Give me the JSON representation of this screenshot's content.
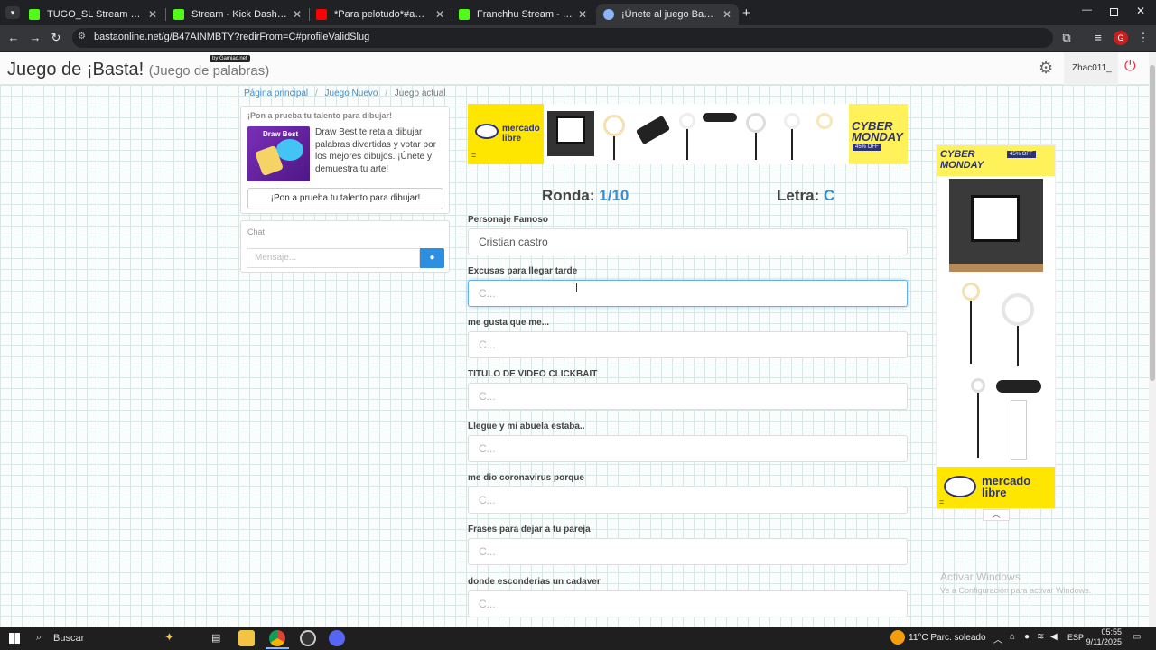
{
  "browser": {
    "tabs": [
      {
        "title": "TUGO_SL Stream - Watch Live o",
        "color": "#53fc18"
      },
      {
        "title": "Stream - Kick Dashboard",
        "color": "#53fc18"
      },
      {
        "title": "*Para pelotudo*#auronplay #tu",
        "color": "#ff0000"
      },
      {
        "title": "Franchhu Stream - Watch Live o",
        "color": "#53fc18"
      },
      {
        "title": "¡Únete al juego Basta!",
        "color": "#8ab4f8"
      }
    ],
    "url": "bastaonline.net/g/B47AINMBTY?redirFrom=C#profileValidSlug",
    "profile_initial": "G"
  },
  "header": {
    "title": "Juego de ¡Basta!",
    "subtitle": "(Juego de palabras)",
    "badge": "by Gamiac.net",
    "username": "Zhac011_"
  },
  "breadcrumb": {
    "home": "Página principal",
    "new_game": "Juego Nuevo",
    "current": "Juego actual",
    "sep": "/"
  },
  "promo": {
    "heading": "¡Pon a prueba tu talento para dibujar!",
    "app_name": "Draw Best",
    "text": "Draw Best te reta a dibujar palabras divertidas y votar por los mejores dibujos. ¡Únete y demuestra tu arte!",
    "button": "¡Pon a prueba tu talento para dibujar!"
  },
  "chat": {
    "label": "Chat",
    "placeholder": "Mensaje..."
  },
  "ads": {
    "brand_line1": "mercado",
    "brand_line2": "libre",
    "cyber_line1": "CYBER",
    "cyber_line2": "MONDAY",
    "discount": "45% OFF",
    "marker": "="
  },
  "game": {
    "round_label": "Ronda:",
    "round_value": "1/10",
    "letter_label": "Letra:",
    "letter_value": "C"
  },
  "fields": [
    {
      "label": "Personaje Famoso",
      "value": "Cristian castro",
      "placeholder": "C..."
    },
    {
      "label": "Excusas para llegar tarde",
      "value": "",
      "placeholder": "C..."
    },
    {
      "label": "me gusta que me...",
      "value": "",
      "placeholder": "C..."
    },
    {
      "label": "TITULO DE VIDEO CLICKBAIT",
      "value": "",
      "placeholder": "C..."
    },
    {
      "label": "Llegue y mi abuela estaba..",
      "value": "",
      "placeholder": "C..."
    },
    {
      "label": "me dio coronavirus porque",
      "value": "",
      "placeholder": "C..."
    },
    {
      "label": "Frases para dejar a tu pareja",
      "value": "",
      "placeholder": "C..."
    },
    {
      "label": "donde esconderias un cadaver",
      "value": "",
      "placeholder": "C..."
    }
  ],
  "watermark": {
    "line1": "Activar Windows",
    "line2": "Ve a Configuración para activar Windows."
  },
  "taskbar": {
    "search": "Buscar",
    "weather": "11°C  Parc. soleado",
    "lang": "ESP",
    "time": "05:55",
    "date": "9/11/2025"
  },
  "colors": {
    "accent_blue": "#3a8fd1",
    "mercado_yellow": "#ffe600",
    "cyber_yellow": "#fff159"
  }
}
